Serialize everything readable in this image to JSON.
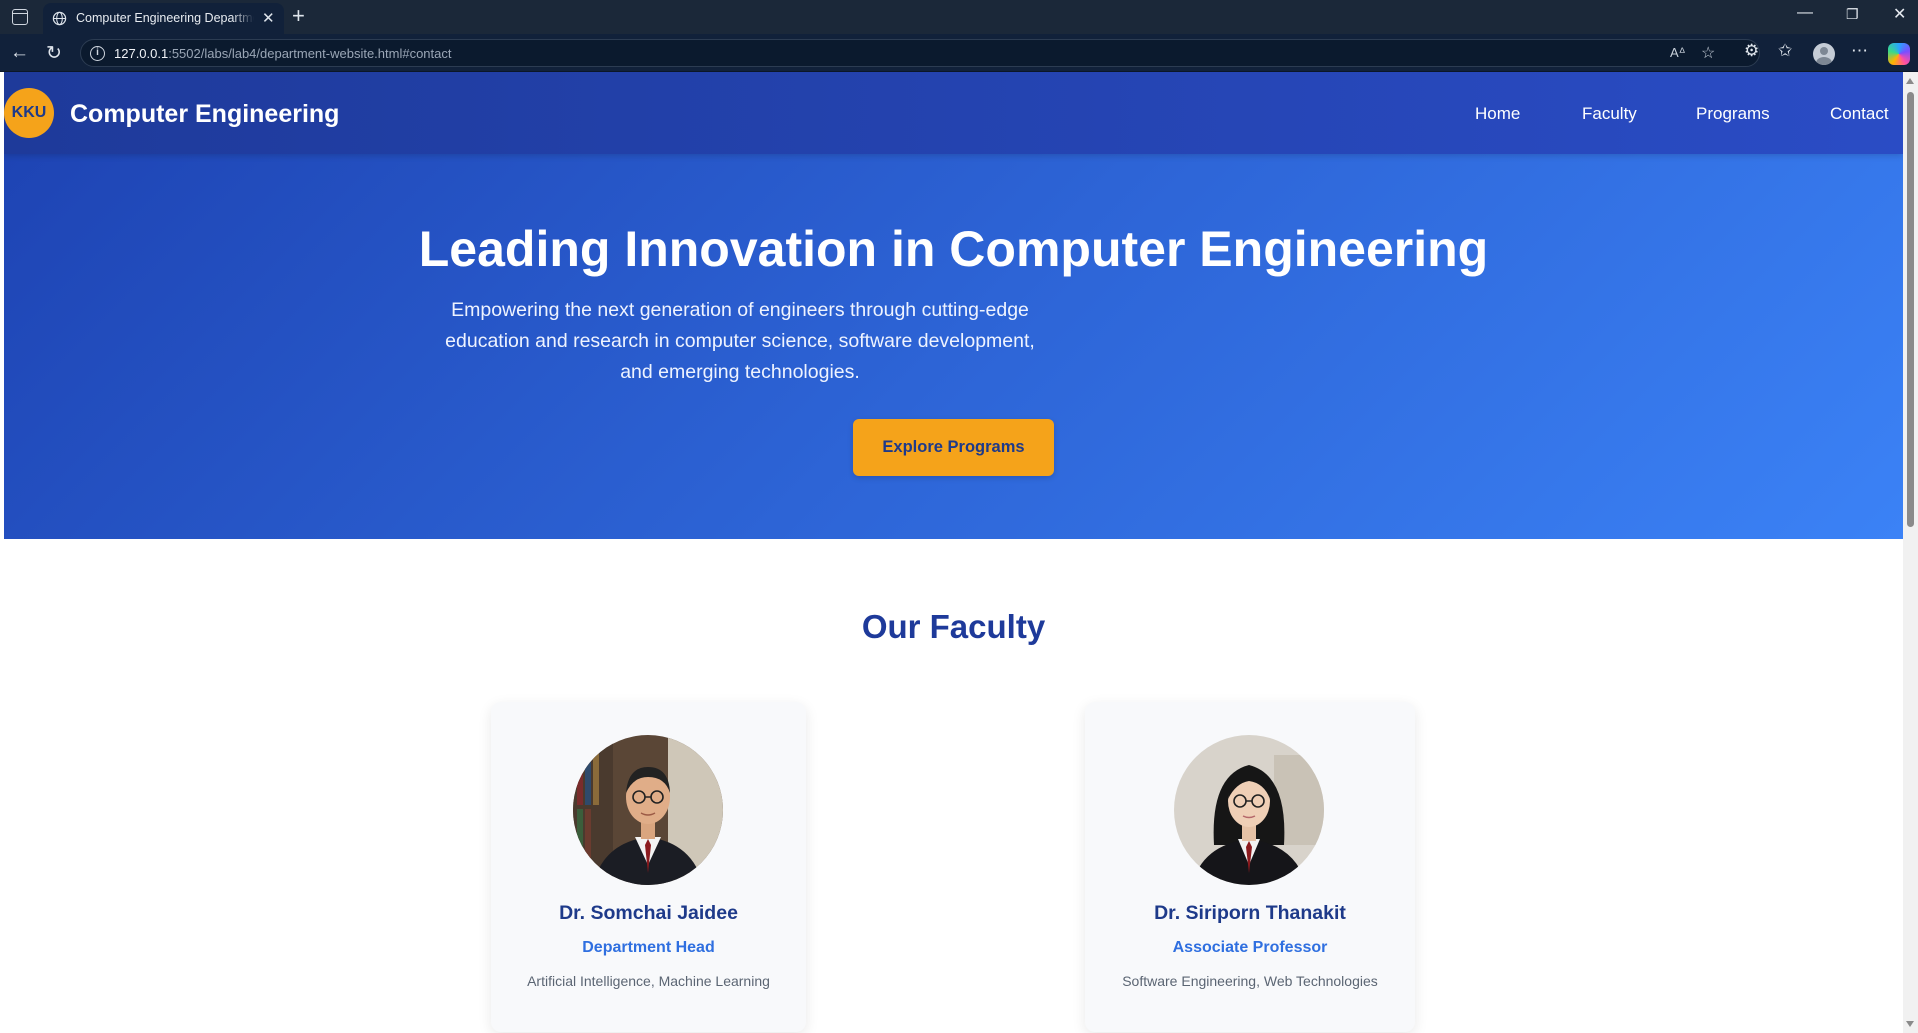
{
  "browser": {
    "tab_title": "Computer Engineering Department",
    "url_host": "127.0.0.1",
    "url_rest": ":5502/labs/lab4/department-website.html#contact"
  },
  "site": {
    "logo_text": "KKU",
    "title": "Computer Engineering",
    "nav": [
      "Home",
      "Faculty",
      "Programs",
      "Contact"
    ]
  },
  "hero": {
    "title": "Leading Innovation in Computer Engineering",
    "subtitle": "Empowering the next generation of engineers through cutting-edge education and research in computer science, software development, and emerging technologies.",
    "button": "Explore Programs"
  },
  "faculty": {
    "title": "Our Faculty",
    "members": [
      {
        "name": "Dr. Somchai Jaidee",
        "role": "Department Head",
        "area": "Artificial Intelligence, Machine Learning"
      },
      {
        "name": "Dr. Siriporn Thanakit",
        "role": "Associate Professor",
        "area": "Software Engineering, Web Technologies"
      }
    ]
  },
  "colors": {
    "header": "#1e3a9a",
    "accent": "#f5a31a",
    "hero_start": "#1e44b4",
    "hero_end": "#3b82f6",
    "link_blue": "#2f6fe0"
  },
  "icons": [
    "tab-actions-icon",
    "globe-icon",
    "close-icon",
    "plus-icon",
    "minimize-icon",
    "restore-icon",
    "back-icon",
    "refresh-icon",
    "info-icon",
    "read-aloud-icon",
    "favorite-icon",
    "extensions-icon",
    "favorites-icon",
    "profile-icon",
    "more-icon",
    "copilot-icon"
  ]
}
